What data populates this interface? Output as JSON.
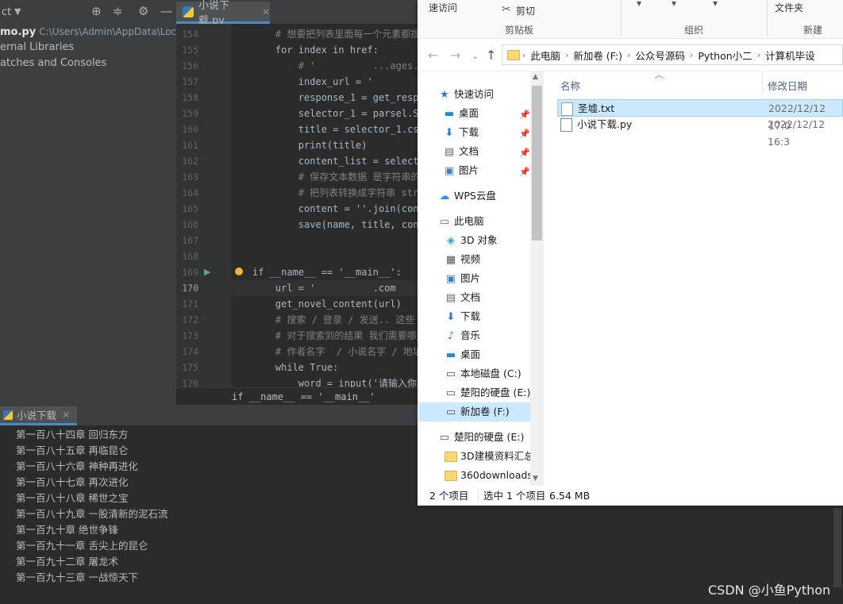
{
  "ide": {
    "project_tool_label": "ct",
    "editor_tab_label": "小说下载.py",
    "project_tree": [
      {
        "name": "mo.py",
        "path": "C:\\Users\\Admin\\AppData\\Loca"
      },
      {
        "name": "ernal Libraries",
        "path": ""
      },
      {
        "name": "atches and Consoles",
        "path": ""
      }
    ],
    "line_numbers": [
      "154",
      "155",
      "156",
      "157",
      "158",
      "159",
      "160",
      "161",
      "162",
      "163",
      "164",
      "165",
      "166",
      "167",
      "168",
      "169",
      "170",
      "171",
      "172",
      "173",
      "174",
      "175",
      "176"
    ],
    "current_line": "170",
    "code_lines": [
      {
        "t": "    # 想要把列表里面每一个元素都提取",
        "k": "cm"
      },
      {
        "t": "    for index in href:",
        "k": "kw"
      },
      {
        "t": "        # '          ...ages.com/",
        "k": "cm"
      },
      {
        "t": "        index_url = '          ...",
        "k": ""
      },
      {
        "t": "        response_1 = get_response(",
        "k": ""
      },
      {
        "t": "        selector_1 = parsel.Select",
        "k": ""
      },
      {
        "t": "        title = selector_1.css('.",
        "k": ""
      },
      {
        "t": "        print(title)",
        "k": ""
      },
      {
        "t": "        content_list = selector_1.",
        "k": ""
      },
      {
        "t": "        # 保存文本数据 是字符串的形",
        "k": "cm"
      },
      {
        "t": "        # 把列表转换成字符串 str()",
        "k": "cm"
      },
      {
        "t": "        content = ''.join(content_",
        "k": ""
      },
      {
        "t": "        save(name, title, content)",
        "k": ""
      },
      {
        "t": "",
        "k": ""
      },
      {
        "t": "",
        "k": ""
      },
      {
        "t": "if __name__ == '__main__':",
        "k": "main"
      },
      {
        "t": "    url = '          .com",
        "k": "url"
      },
      {
        "t": "    get_novel_content(url)",
        "k": ""
      },
      {
        "t": "    # 搜索 / 登录 / 发送.. 这些 pos",
        "k": "cm"
      },
      {
        "t": "    # 对于搜索到的结果 我们需要哪些",
        "k": "cm"
      },
      {
        "t": "    # 作者名字  / 小说名字 / 地址(书",
        "k": "cm"
      },
      {
        "t": "    while True:",
        "k": "kw"
      },
      {
        "t": "        word = input('请输入你要下载",
        "k": "in"
      }
    ],
    "breadcrumb": "if __name__ == '__main__'",
    "run_tab_label": "小说下载",
    "console_output": [
      "第一百八十四章 回归东方",
      "第一百八十五章 再临昆仑",
      "第一百八十六章 神种再进化",
      "第一百八十七章 再次进化",
      "第一百八十八章 稀世之宝",
      "第一百八十九章 一股清新的泥石流",
      "第一百九十章 绝世争锋",
      "第一百九十一章 舌尖上的昆仑",
      "第一百九十二章 屠龙术",
      "第一百九十三章 一战惊天下"
    ],
    "watermark": "CSDN @小鱼Python"
  },
  "explorer": {
    "ribbon": {
      "quick_access": "速访问",
      "cut": "剪切",
      "clipboard": "剪贴板",
      "organize": "组织",
      "folder": "文件夹",
      "new": "新建"
    },
    "address": [
      "此电脑",
      "新加卷 (F:)",
      "公众号源码",
      "Python小二",
      "计算机毕设"
    ],
    "nav": {
      "quick_access": "快速访问",
      "desktop": "桌面",
      "downloads": "下载",
      "documents": "文档",
      "pictures": "图片",
      "wps": "WPS云盘",
      "this_pc": "此电脑",
      "objects3d": "3D 对象",
      "videos": "视频",
      "pictures2": "图片",
      "documents2": "文档",
      "downloads2": "下载",
      "music": "音乐",
      "desktop2": "桌面",
      "drive_c": "本地磁盘 (C:)",
      "drive_e": "楚阳的硬盘 (E:)",
      "drive_f": "新加卷 (F:)",
      "drive_e2": "楚阳的硬盘 (E:)",
      "folder_3d": "3D建模资料汇总",
      "folder_360": "360downloads"
    },
    "columns": {
      "name": "名称",
      "date": "修改日期"
    },
    "files": [
      {
        "name": "圣墟.txt",
        "date": "2022/12/12 17:0"
      },
      {
        "name": "小说下载.py",
        "date": "2022/12/12 16:3"
      }
    ],
    "status": {
      "count": "2 个项目",
      "selected": "选中 1 个项目",
      "size": "6.54 MB"
    },
    "colors": {
      "selection": "#cce8ff",
      "accent": "#0078d7"
    }
  }
}
